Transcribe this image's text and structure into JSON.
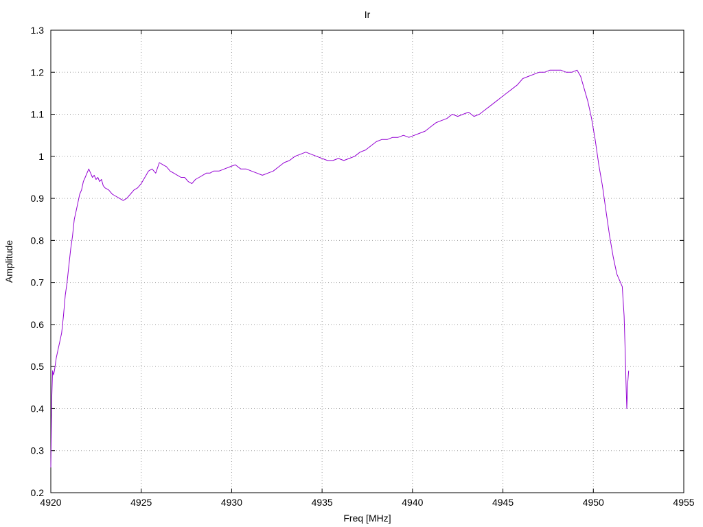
{
  "chart_data": {
    "type": "line",
    "title": "Ir",
    "xlabel": "Freq [MHz]",
    "ylabel": "Amplitude",
    "xlim": [
      4920,
      4955
    ],
    "ylim": [
      0.2,
      1.3
    ],
    "xticks": [
      4920,
      4925,
      4930,
      4935,
      4940,
      4945,
      4950,
      4955
    ],
    "xtick_labels": [
      "4920",
      "4925",
      "4930",
      "4935",
      "4940",
      "4945",
      "4950",
      "4955"
    ],
    "yticks": [
      0.2,
      0.3,
      0.4,
      0.5,
      0.6,
      0.7,
      0.8,
      0.9,
      1.0,
      1.1,
      1.2,
      1.3
    ],
    "ytick_labels": [
      "0.2",
      "0.3",
      "0.4",
      "0.5",
      "0.6",
      "0.7",
      "0.8",
      "0.9",
      "1",
      "1.1",
      "1.2",
      "1.3"
    ],
    "grid": true,
    "series": [
      {
        "color": "#9400d3",
        "x": [
          4920.0,
          4920.05,
          4920.1,
          4920.15,
          4920.2,
          4920.3,
          4920.4,
          4920.5,
          4920.6,
          4920.7,
          4920.8,
          4920.9,
          4921.0,
          4921.1,
          4921.2,
          4921.3,
          4921.4,
          4921.5,
          4921.6,
          4921.7,
          4921.8,
          4921.9,
          4922.0,
          4922.1,
          4922.2,
          4922.3,
          4922.4,
          4922.5,
          4922.6,
          4922.7,
          4922.8,
          4922.9,
          4923.0,
          4923.2,
          4923.4,
          4923.6,
          4923.8,
          4924.0,
          4924.2,
          4924.4,
          4924.6,
          4924.8,
          4925.0,
          4925.2,
          4925.4,
          4925.6,
          4925.8,
          4926.0,
          4926.2,
          4926.4,
          4926.6,
          4926.8,
          4927.0,
          4927.2,
          4927.4,
          4927.6,
          4927.8,
          4928.0,
          4928.2,
          4928.4,
          4928.6,
          4928.8,
          4929.0,
          4929.3,
          4929.6,
          4929.9,
          4930.2,
          4930.5,
          4930.8,
          4931.1,
          4931.4,
          4931.7,
          4932.0,
          4932.3,
          4932.6,
          4932.9,
          4933.2,
          4933.5,
          4933.8,
          4934.1,
          4934.4,
          4934.7,
          4935.0,
          4935.3,
          4935.6,
          4935.9,
          4936.2,
          4936.5,
          4936.8,
          4937.1,
          4937.4,
          4937.7,
          4938.0,
          4938.3,
          4938.6,
          4938.9,
          4939.2,
          4939.5,
          4939.8,
          4940.1,
          4940.4,
          4940.7,
          4941.0,
          4941.3,
          4941.6,
          4941.9,
          4942.2,
          4942.5,
          4942.8,
          4943.1,
          4943.4,
          4943.7,
          4944.0,
          4944.3,
          4944.6,
          4944.9,
          4945.2,
          4945.5,
          4945.8,
          4946.1,
          4946.4,
          4946.7,
          4947.0,
          4947.3,
          4947.6,
          4947.9,
          4948.2,
          4948.5,
          4948.8,
          4949.1,
          4949.3,
          4949.5,
          4949.7,
          4949.9,
          4950.1,
          4950.3,
          4950.5,
          4950.7,
          4950.9,
          4951.1,
          4951.3,
          4951.5,
          4951.6,
          4951.7,
          4951.75,
          4951.8,
          4951.85,
          4951.9,
          4951.95
        ],
        "y": [
          0.26,
          0.42,
          0.49,
          0.48,
          0.49,
          0.52,
          0.54,
          0.56,
          0.58,
          0.62,
          0.67,
          0.7,
          0.74,
          0.78,
          0.81,
          0.85,
          0.87,
          0.89,
          0.91,
          0.92,
          0.94,
          0.95,
          0.96,
          0.97,
          0.96,
          0.95,
          0.955,
          0.945,
          0.95,
          0.94,
          0.945,
          0.93,
          0.925,
          0.92,
          0.91,
          0.905,
          0.9,
          0.895,
          0.9,
          0.91,
          0.92,
          0.925,
          0.935,
          0.95,
          0.965,
          0.97,
          0.96,
          0.985,
          0.98,
          0.975,
          0.965,
          0.96,
          0.955,
          0.95,
          0.95,
          0.94,
          0.935,
          0.945,
          0.95,
          0.955,
          0.96,
          0.96,
          0.965,
          0.965,
          0.97,
          0.975,
          0.98,
          0.97,
          0.97,
          0.965,
          0.96,
          0.955,
          0.96,
          0.965,
          0.975,
          0.985,
          0.99,
          1.0,
          1.005,
          1.01,
          1.005,
          1.0,
          0.995,
          0.99,
          0.99,
          0.995,
          0.99,
          0.995,
          1.0,
          1.01,
          1.015,
          1.025,
          1.035,
          1.04,
          1.04,
          1.045,
          1.045,
          1.05,
          1.045,
          1.05,
          1.055,
          1.06,
          1.07,
          1.08,
          1.085,
          1.09,
          1.1,
          1.095,
          1.1,
          1.105,
          1.095,
          1.1,
          1.11,
          1.12,
          1.13,
          1.14,
          1.15,
          1.16,
          1.17,
          1.185,
          1.19,
          1.195,
          1.2,
          1.2,
          1.205,
          1.205,
          1.205,
          1.2,
          1.2,
          1.205,
          1.19,
          1.16,
          1.13,
          1.09,
          1.04,
          0.98,
          0.93,
          0.87,
          0.81,
          0.76,
          0.72,
          0.7,
          0.69,
          0.62,
          0.55,
          0.47,
          0.4,
          0.46,
          0.49
        ]
      }
    ]
  }
}
